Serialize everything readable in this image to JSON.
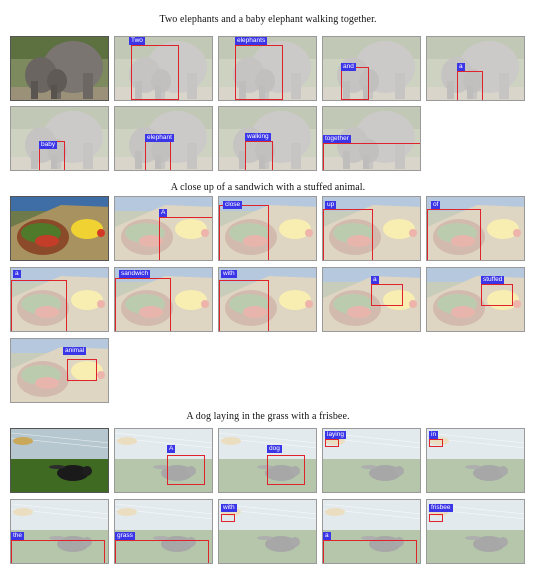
{
  "panels": [
    {
      "caption": "Two elephants and a baby elephant walking together.",
      "scene": "elephants",
      "words": [
        "Two",
        "elephants",
        "and",
        "a",
        "baby",
        "elephant",
        "walking",
        "together"
      ]
    },
    {
      "caption": "A close up of a sandwich with a stuffed animal.",
      "scene": "sandwich",
      "words": [
        "A",
        "close",
        "up",
        "of",
        "a",
        "sandwich",
        "with",
        "a",
        "stuffed",
        "animal"
      ]
    },
    {
      "caption": "A dog laying in the grass with a frisbee.",
      "scene": "dog",
      "words": [
        "A",
        "dog",
        "laying",
        "in",
        "the",
        "grass",
        "with",
        "a",
        "frisbee"
      ]
    }
  ],
  "colors": {
    "box": "#e0232b",
    "tag": "#3b35e8"
  }
}
